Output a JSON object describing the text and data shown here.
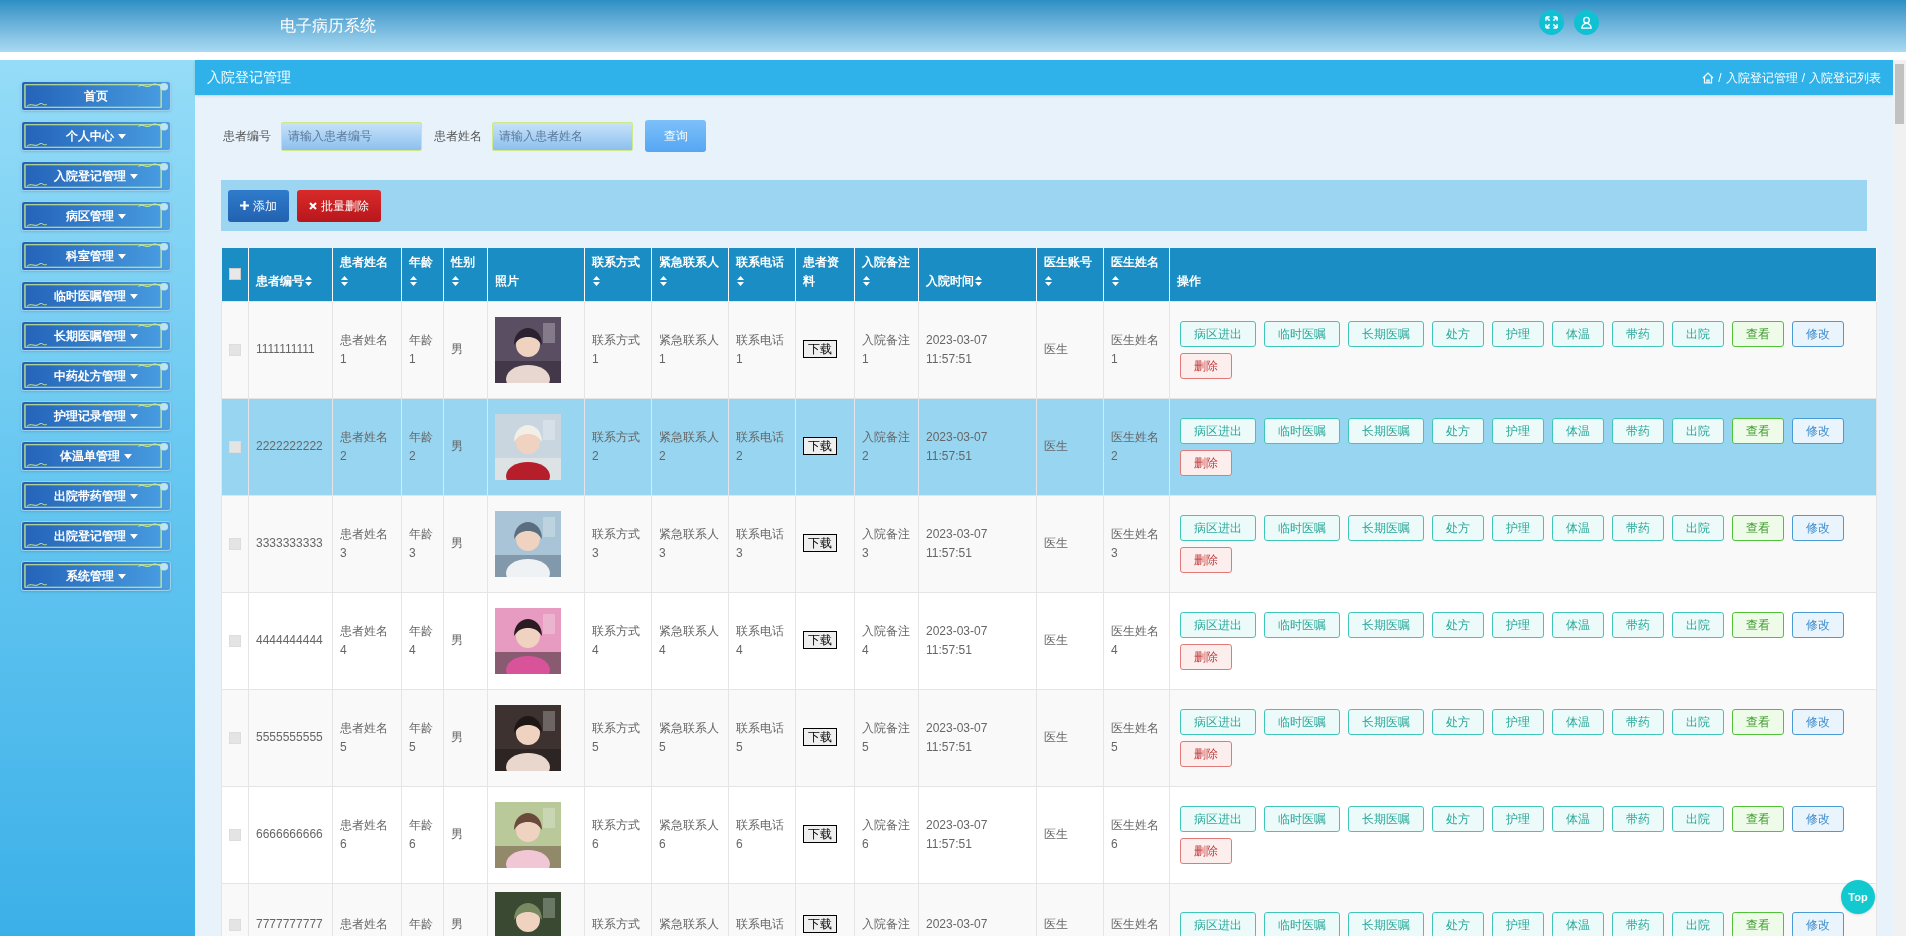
{
  "app_title": "电子病历系统",
  "sidebar": {
    "items": [
      {
        "label": "首页",
        "has_menu": false
      },
      {
        "label": "个人中心",
        "has_menu": true
      },
      {
        "label": "入院登记管理",
        "has_menu": true
      },
      {
        "label": "病区管理",
        "has_menu": true
      },
      {
        "label": "科室管理",
        "has_menu": true
      },
      {
        "label": "临时医嘱管理",
        "has_menu": true
      },
      {
        "label": "长期医嘱管理",
        "has_menu": true
      },
      {
        "label": "中药处方管理",
        "has_menu": true
      },
      {
        "label": "护理记录管理",
        "has_menu": true
      },
      {
        "label": "体温单管理",
        "has_menu": true
      },
      {
        "label": "出院带药管理",
        "has_menu": true
      },
      {
        "label": "出院登记管理",
        "has_menu": true
      },
      {
        "label": "系统管理",
        "has_menu": true
      }
    ]
  },
  "page_title": "入院登记管理",
  "breadcrumb": [
    {
      "separator": "/",
      "label": "入院登记管理"
    },
    {
      "separator": "/",
      "label": "入院登记列表"
    }
  ],
  "search": {
    "fields": [
      {
        "label": "患者编号",
        "placeholder": "请输入患者编号"
      },
      {
        "label": "患者姓名",
        "placeholder": "请输入患者姓名"
      }
    ],
    "button": "查询"
  },
  "toolbar": [
    {
      "kind": "add",
      "label": "添加"
    },
    {
      "kind": "delete",
      "label": "批量删除"
    }
  ],
  "table": {
    "select_all": {
      "checked": false
    },
    "columns": [
      {
        "label": "患者编号",
        "sortable": true
      },
      {
        "label": "患者姓名",
        "sortable": true
      },
      {
        "label": "年龄",
        "sortable": true
      },
      {
        "label": "性别",
        "sortable": true
      },
      {
        "label": "照片",
        "sortable": false
      },
      {
        "label": "联系方式",
        "sortable": true
      },
      {
        "label": "紧急联系人",
        "sortable": true
      },
      {
        "label": "联系电话",
        "sortable": true
      },
      {
        "label": "患者资料",
        "sortable": false
      },
      {
        "label": "入院备注",
        "sortable": true
      },
      {
        "label": "入院时间",
        "sortable": true
      },
      {
        "label": "医生账号",
        "sortable": true
      },
      {
        "label": "医生姓名",
        "sortable": true
      },
      {
        "label": "操作",
        "sortable": false
      }
    ],
    "rows": [
      {
        "selected": false,
        "checked": false,
        "cells": [
          "1111111111",
          "患者姓名1",
          "年龄1",
          "男",
          {
            "kind": "picture"
          },
          "联系方式1",
          "紧急联系人1",
          "联系电话1",
          {
            "kind": "download",
            "label": "下载"
          },
          "入院备注1",
          "2023-03-07 11:57:51",
          "医生",
          "医生姓名1"
        ],
        "actions": [
          {
            "kind": "plain",
            "label": "病区进出"
          },
          {
            "kind": "plain",
            "label": "临时医嘱"
          },
          {
            "kind": "plain",
            "label": "长期医嘱"
          },
          {
            "kind": "plain",
            "label": "处方"
          },
          {
            "kind": "plain",
            "label": "护理"
          },
          {
            "kind": "plain",
            "label": "体温"
          },
          {
            "kind": "plain",
            "label": "带药"
          },
          {
            "kind": "plain",
            "label": "出院"
          },
          {
            "kind": "view",
            "label": "查看"
          },
          {
            "kind": "edit",
            "label": "修改"
          },
          {
            "kind": "delete",
            "label": "删除"
          }
        ]
      },
      {
        "selected": true,
        "checked": false,
        "cells": [
          "2222222222",
          "患者姓名2",
          "年龄2",
          "男",
          {
            "kind": "picture"
          },
          "联系方式2",
          "紧急联系人2",
          "联系电话2",
          {
            "kind": "download",
            "label": "下载"
          },
          "入院备注2",
          "2023-03-07 11:57:51",
          "医生",
          "医生姓名2"
        ],
        "actions": [
          {
            "kind": "plain",
            "label": "病区进出"
          },
          {
            "kind": "plain",
            "label": "临时医嘱"
          },
          {
            "kind": "plain",
            "label": "长期医嘱"
          },
          {
            "kind": "plain",
            "label": "处方"
          },
          {
            "kind": "plain",
            "label": "护理"
          },
          {
            "kind": "plain",
            "label": "体温"
          },
          {
            "kind": "plain",
            "label": "带药"
          },
          {
            "kind": "plain",
            "label": "出院"
          },
          {
            "kind": "view",
            "label": "查看"
          },
          {
            "kind": "edit",
            "label": "修改"
          },
          {
            "kind": "delete",
            "label": "删除"
          }
        ]
      },
      {
        "selected": false,
        "checked": false,
        "cells": [
          "3333333333",
          "患者姓名3",
          "年龄3",
          "男",
          {
            "kind": "picture"
          },
          "联系方式3",
          "紧急联系人3",
          "联系电话3",
          {
            "kind": "download",
            "label": "下载"
          },
          "入院备注3",
          "2023-03-07 11:57:51",
          "医生",
          "医生姓名3"
        ],
        "actions": [
          {
            "kind": "plain",
            "label": "病区进出"
          },
          {
            "kind": "plain",
            "label": "临时医嘱"
          },
          {
            "kind": "plain",
            "label": "长期医嘱"
          },
          {
            "kind": "plain",
            "label": "处方"
          },
          {
            "kind": "plain",
            "label": "护理"
          },
          {
            "kind": "plain",
            "label": "体温"
          },
          {
            "kind": "plain",
            "label": "带药"
          },
          {
            "kind": "plain",
            "label": "出院"
          },
          {
            "kind": "view",
            "label": "查看"
          },
          {
            "kind": "edit",
            "label": "修改"
          },
          {
            "kind": "delete",
            "label": "删除"
          }
        ]
      },
      {
        "selected": false,
        "checked": false,
        "cells": [
          "4444444444",
          "患者姓名4",
          "年龄4",
          "男",
          {
            "kind": "picture"
          },
          "联系方式4",
          "紧急联系人4",
          "联系电话4",
          {
            "kind": "download",
            "label": "下载"
          },
          "入院备注4",
          "2023-03-07 11:57:51",
          "医生",
          "医生姓名4"
        ],
        "actions": [
          {
            "kind": "plain",
            "label": "病区进出"
          },
          {
            "kind": "plain",
            "label": "临时医嘱"
          },
          {
            "kind": "plain",
            "label": "长期医嘱"
          },
          {
            "kind": "plain",
            "label": "处方"
          },
          {
            "kind": "plain",
            "label": "护理"
          },
          {
            "kind": "plain",
            "label": "体温"
          },
          {
            "kind": "plain",
            "label": "带药"
          },
          {
            "kind": "plain",
            "label": "出院"
          },
          {
            "kind": "view",
            "label": "查看"
          },
          {
            "kind": "edit",
            "label": "修改"
          },
          {
            "kind": "delete",
            "label": "删除"
          }
        ]
      },
      {
        "selected": false,
        "checked": false,
        "cells": [
          "5555555555",
          "患者姓名5",
          "年龄5",
          "男",
          {
            "kind": "picture"
          },
          "联系方式5",
          "紧急联系人5",
          "联系电话5",
          {
            "kind": "download",
            "label": "下载"
          },
          "入院备注5",
          "2023-03-07 11:57:51",
          "医生",
          "医生姓名5"
        ],
        "actions": [
          {
            "kind": "plain",
            "label": "病区进出"
          },
          {
            "kind": "plain",
            "label": "临时医嘱"
          },
          {
            "kind": "plain",
            "label": "长期医嘱"
          },
          {
            "kind": "plain",
            "label": "处方"
          },
          {
            "kind": "plain",
            "label": "护理"
          },
          {
            "kind": "plain",
            "label": "体温"
          },
          {
            "kind": "plain",
            "label": "带药"
          },
          {
            "kind": "plain",
            "label": "出院"
          },
          {
            "kind": "view",
            "label": "查看"
          },
          {
            "kind": "edit",
            "label": "修改"
          },
          {
            "kind": "delete",
            "label": "删除"
          }
        ]
      },
      {
        "selected": false,
        "checked": false,
        "cells": [
          "6666666666",
          "患者姓名6",
          "年龄6",
          "男",
          {
            "kind": "picture"
          },
          "联系方式6",
          "紧急联系人6",
          "联系电话6",
          {
            "kind": "download",
            "label": "下载"
          },
          "入院备注6",
          "2023-03-07 11:57:51",
          "医生",
          "医生姓名6"
        ],
        "actions": [
          {
            "kind": "plain",
            "label": "病区进出"
          },
          {
            "kind": "plain",
            "label": "临时医嘱"
          },
          {
            "kind": "plain",
            "label": "长期医嘱"
          },
          {
            "kind": "plain",
            "label": "处方"
          },
          {
            "kind": "plain",
            "label": "护理"
          },
          {
            "kind": "plain",
            "label": "体温"
          },
          {
            "kind": "plain",
            "label": "带药"
          },
          {
            "kind": "plain",
            "label": "出院"
          },
          {
            "kind": "view",
            "label": "查看"
          },
          {
            "kind": "edit",
            "label": "修改"
          },
          {
            "kind": "delete",
            "label": "删除"
          }
        ]
      },
      {
        "selected": false,
        "checked": false,
        "cells": [
          "7777777777",
          "患者姓名",
          "年龄",
          "男",
          {
            "kind": "picture"
          },
          "联系方式",
          "紧急联系人",
          "联系电话",
          {
            "kind": "download",
            "label": "下载"
          },
          "入院备注",
          "2023-03-07",
          "医生",
          "医生姓名"
        ],
        "actions": [
          {
            "kind": "plain",
            "label": "病区进出"
          },
          {
            "kind": "plain",
            "label": "临时医嘱"
          },
          {
            "kind": "plain",
            "label": "长期医嘱"
          },
          {
            "kind": "plain",
            "label": "处方"
          },
          {
            "kind": "plain",
            "label": "护理"
          },
          {
            "kind": "plain",
            "label": "体温"
          },
          {
            "kind": "plain",
            "label": "带药"
          },
          {
            "kind": "plain",
            "label": "出院"
          },
          {
            "kind": "view",
            "label": "查看"
          },
          {
            "kind": "edit",
            "label": "修改"
          }
        ]
      }
    ]
  },
  "back_to_top": "Top"
}
